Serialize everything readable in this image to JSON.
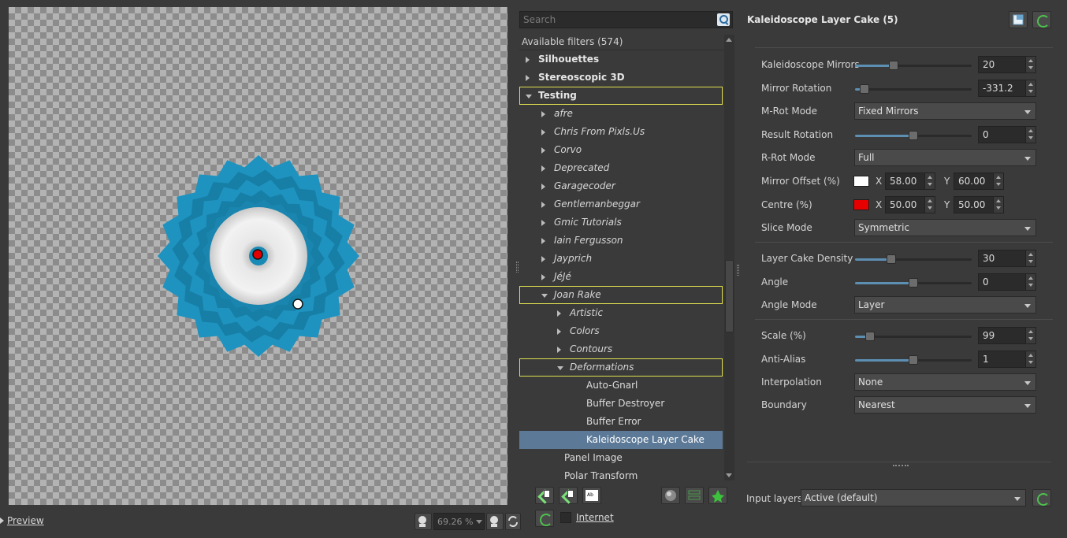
{
  "preview": {
    "toggle_label": "Preview",
    "zoom_value": "69.26 %"
  },
  "filters": {
    "search_placeholder": "Search",
    "header": "Available filters (574)",
    "rows": [
      {
        "label": "Silhouettes",
        "style": "bold",
        "arrow": "closed",
        "indent": 0
      },
      {
        "label": "Stereoscopic 3D",
        "style": "bold",
        "arrow": "closed",
        "indent": 0
      },
      {
        "label": "Testing",
        "style": "bold",
        "arrow": "open",
        "indent": 0,
        "highlight": true
      },
      {
        "label": "afre",
        "style": "ital",
        "arrow": "closed",
        "indent": 1
      },
      {
        "label": "Chris From Pixls.Us",
        "style": "ital",
        "arrow": "closed",
        "indent": 1
      },
      {
        "label": "Corvo",
        "style": "ital",
        "arrow": "closed",
        "indent": 1
      },
      {
        "label": "Deprecated",
        "style": "ital",
        "arrow": "closed",
        "indent": 1
      },
      {
        "label": "Garagecoder",
        "style": "ital",
        "arrow": "closed",
        "indent": 1
      },
      {
        "label": "Gentlemanbeggar",
        "style": "ital",
        "arrow": "closed",
        "indent": 1
      },
      {
        "label": "Gmic Tutorials",
        "style": "ital",
        "arrow": "closed",
        "indent": 1
      },
      {
        "label": "Iain Fergusson",
        "style": "ital",
        "arrow": "closed",
        "indent": 1
      },
      {
        "label": "Jayprich",
        "style": "ital",
        "arrow": "closed",
        "indent": 1
      },
      {
        "label": "JéJé",
        "style": "ital",
        "arrow": "closed",
        "indent": 1
      },
      {
        "label": "Joan Rake",
        "style": "ital",
        "arrow": "open",
        "indent": 1,
        "highlight": true
      },
      {
        "label": "Artistic",
        "style": "ital",
        "arrow": "closed",
        "indent": 2
      },
      {
        "label": "Colors",
        "style": "ital",
        "arrow": "closed",
        "indent": 2
      },
      {
        "label": "Contours",
        "style": "ital",
        "arrow": "closed",
        "indent": 2
      },
      {
        "label": "Deformations",
        "style": "ital",
        "arrow": "open",
        "indent": 2,
        "highlight": true
      },
      {
        "label": "Auto-Gnarl",
        "style": "plain",
        "arrow": "none",
        "indent": 3
      },
      {
        "label": "Buffer Destroyer",
        "style": "plain",
        "arrow": "none",
        "indent": 3
      },
      {
        "label": "Buffer Error",
        "style": "plain",
        "arrow": "none",
        "indent": 3
      },
      {
        "label": "Kaleidoscope Layer Cake",
        "style": "plain",
        "arrow": "none",
        "indent": 3,
        "selected": true
      },
      {
        "label": "Panel Image",
        "style": "plain",
        "arrow": "none",
        "indent": 1.6
      },
      {
        "label": "Polar Transform",
        "style": "plain",
        "arrow": "none",
        "indent": 1.6
      }
    ],
    "internet_label": "Internet"
  },
  "params": {
    "title": "Kaleidoscope Layer Cake (5)",
    "kaleidoscope_mirrors": {
      "label": "Kaleidoscope Mirrors",
      "value": "20",
      "level": 0.33
    },
    "mirror_rotation": {
      "label": "Mirror Rotation",
      "value": "-331.2",
      "level": 0.08
    },
    "m_rot_mode": {
      "label": "M-Rot Mode",
      "value": "Fixed Mirrors"
    },
    "result_rotation": {
      "label": "Result Rotation",
      "value": "0",
      "level": 0.5
    },
    "r_rot_mode": {
      "label": "R-Rot Mode",
      "value": "Full"
    },
    "mirror_offset": {
      "label": "Mirror Offset (%)",
      "x_label": "X",
      "x": "58.00",
      "y_label": "Y",
      "y": "60.00",
      "color": "#ffffff"
    },
    "centre": {
      "label": "Centre (%)",
      "x_label": "X",
      "x": "50.00",
      "y_label": "Y",
      "y": "50.00",
      "color": "#e60000"
    },
    "slice_mode": {
      "label": "Slice Mode",
      "value": "Symmetric"
    },
    "layer_cake_density": {
      "label": "Layer Cake Density",
      "value": "30",
      "level": 0.31
    },
    "angle": {
      "label": "Angle",
      "value": "0",
      "level": 0.5
    },
    "angle_mode": {
      "label": "Angle Mode",
      "value": "Layer"
    },
    "scale": {
      "label": "Scale (%)",
      "value": "99",
      "level": 0.13
    },
    "anti_alias": {
      "label": "Anti-Alias",
      "value": "1",
      "level": 0.5
    },
    "interpolation": {
      "label": "Interpolation",
      "value": "None"
    },
    "boundary": {
      "label": "Boundary",
      "value": "Nearest"
    },
    "input_layers_label": "Input layers",
    "input_layers_value": "Active (default)"
  },
  "colors": {
    "accent": "#5d8fb3",
    "selection": "#5c7a98",
    "highlight_outline": "#e0e050",
    "kaleido_outer": "#1f93c0",
    "kaleido_ring": "#177fa6"
  }
}
